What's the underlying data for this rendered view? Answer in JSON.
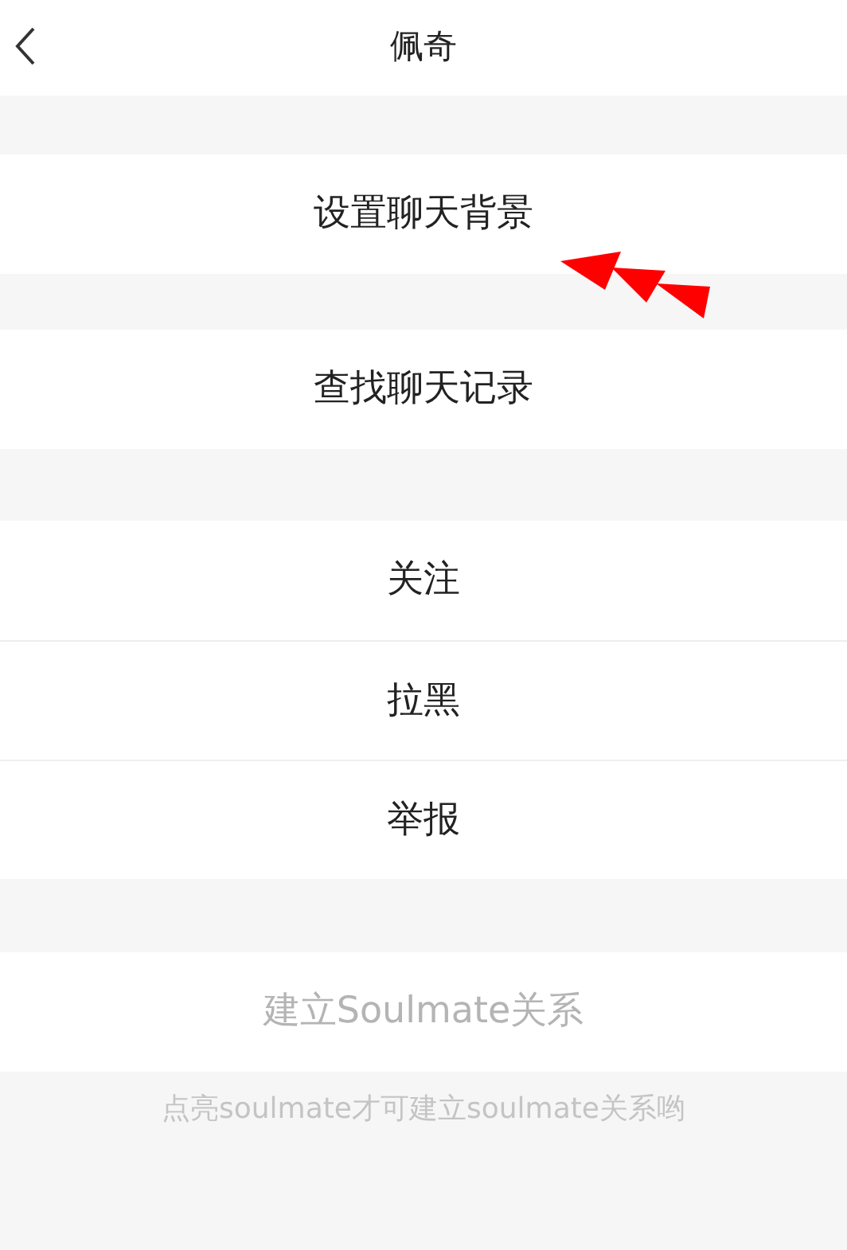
{
  "header": {
    "title": "佩奇"
  },
  "groups": [
    {
      "items": [
        {
          "label": "设置聊天背景",
          "disabled": false
        }
      ]
    },
    {
      "items": [
        {
          "label": "查找聊天记录",
          "disabled": false
        }
      ]
    },
    {
      "items": [
        {
          "label": "关注",
          "disabled": false
        },
        {
          "label": "拉黑",
          "disabled": false
        },
        {
          "label": "举报",
          "disabled": false
        }
      ]
    },
    {
      "items": [
        {
          "label": "建立Soulmate关系",
          "disabled": true
        }
      ]
    }
  ],
  "hint": "点亮soulmate才可建立soulmate关系哟"
}
